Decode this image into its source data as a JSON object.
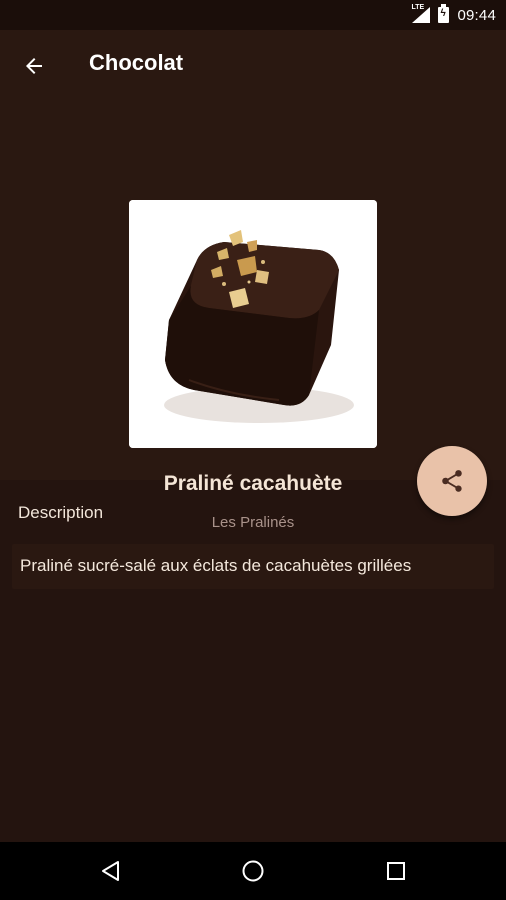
{
  "status_bar": {
    "network_label": "LTE",
    "time": "09:44",
    "icons": [
      "lte-signal-icon",
      "battery-charging-icon"
    ]
  },
  "app_bar": {
    "title": "Chocolat",
    "back_icon": "arrow-back-icon"
  },
  "product": {
    "name": "Praliné cacahuète",
    "category": "Les Pralinés",
    "image_icon": "chocolate-praline-photo"
  },
  "share": {
    "icon": "share-icon",
    "color": "#e9c2a9"
  },
  "description": {
    "label": "Description",
    "text": "Praliné sucré-salé aux éclats de cacahuètes grillées"
  },
  "nav_bar": {
    "icons": [
      "back-triangle-icon",
      "home-circle-icon",
      "recents-square-icon"
    ]
  },
  "colors": {
    "background": "#24140f",
    "surface": "#2a1811",
    "accent": "#e9c2a9"
  }
}
